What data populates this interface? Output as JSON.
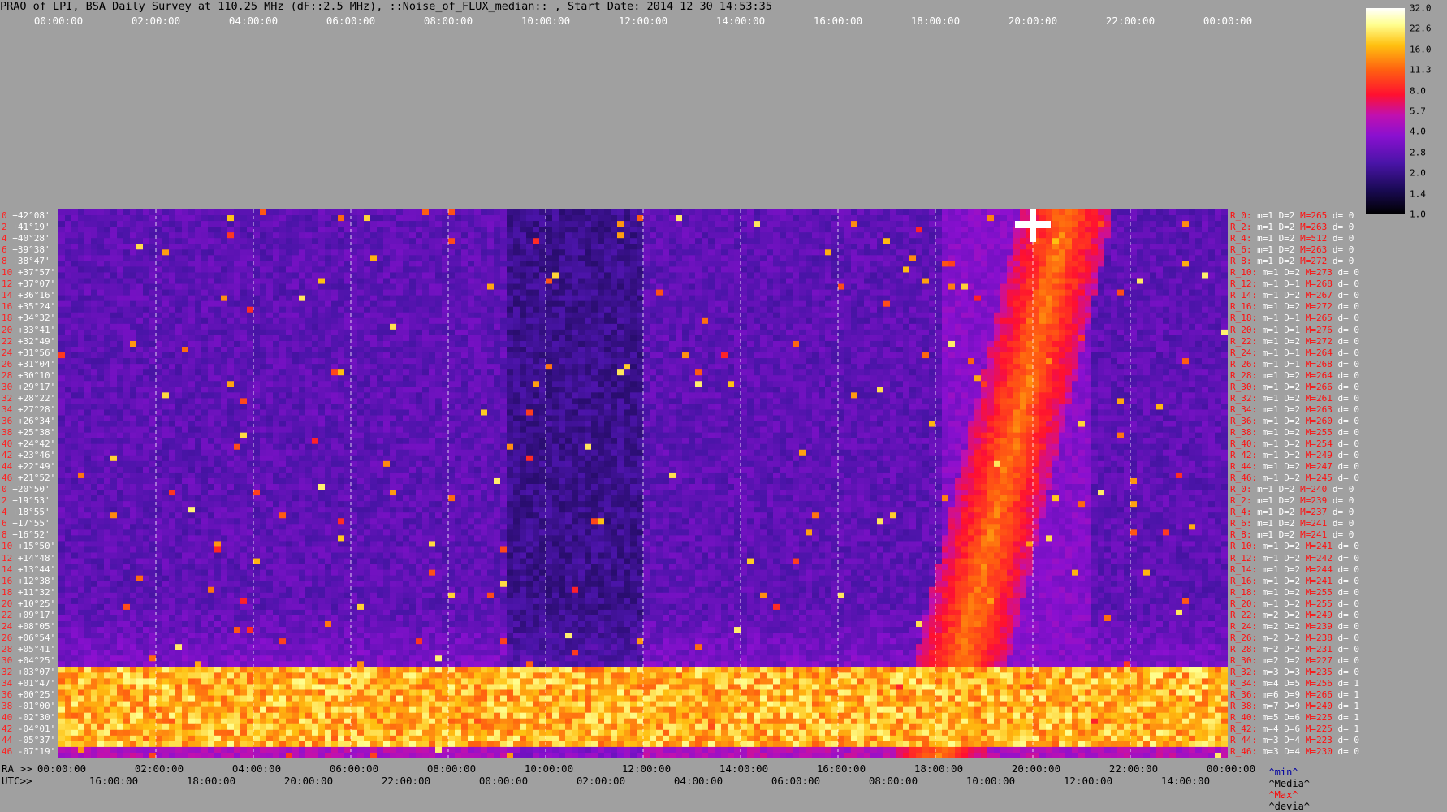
{
  "title": "PRAO of LPI, BSA Daily Survey at 110.25 MHz (dF::2.5 MHz), ::Noise_of_FLUX_median:: , Start Date: 2014 12 30 14:53:35",
  "top_axis_labels": [
    "00:00:00",
    "02:00:00",
    "04:00:00",
    "06:00:00",
    "08:00:00",
    "10:00:00",
    "12:00:00",
    "14:00:00",
    "16:00:00",
    "18:00:00",
    "20:00:00",
    "22:00:00",
    "00:00:00"
  ],
  "ra_axis": {
    "prefix": "RA >>",
    "labels": [
      "00:00:00",
      "02:00:00",
      "04:00:00",
      "06:00:00",
      "08:00:00",
      "10:00:00",
      "12:00:00",
      "14:00:00",
      "16:00:00",
      "18:00:00",
      "20:00:00",
      "22:00:00",
      "00:00:00"
    ]
  },
  "utc_axis": {
    "prefix": "UTC>>",
    "labels": [
      "16:00:00",
      "18:00:00",
      "20:00:00",
      "22:00:00",
      "00:00:00",
      "02:00:00",
      "04:00:00",
      "06:00:00",
      "08:00:00",
      "10:00:00",
      "12:00:00",
      "14:00:00"
    ]
  },
  "declinations": [
    {
      "i": "0",
      "d": "+42°08'"
    },
    {
      "i": "2",
      "d": "+41°19'"
    },
    {
      "i": "4",
      "d": "+40°28'"
    },
    {
      "i": "6",
      "d": "+39°38'"
    },
    {
      "i": "8",
      "d": "+38°47'"
    },
    {
      "i": "10",
      "d": "+37°57'"
    },
    {
      "i": "12",
      "d": "+37°07'"
    },
    {
      "i": "14",
      "d": "+36°16'"
    },
    {
      "i": "16",
      "d": "+35°24'"
    },
    {
      "i": "18",
      "d": "+34°32'"
    },
    {
      "i": "20",
      "d": "+33°41'"
    },
    {
      "i": "22",
      "d": "+32°49'"
    },
    {
      "i": "24",
      "d": "+31°56'"
    },
    {
      "i": "26",
      "d": "+31°04'"
    },
    {
      "i": "28",
      "d": "+30°10'"
    },
    {
      "i": "30",
      "d": "+29°17'"
    },
    {
      "i": "32",
      "d": "+28°22'"
    },
    {
      "i": "34",
      "d": "+27°28'"
    },
    {
      "i": "36",
      "d": "+26°34'"
    },
    {
      "i": "38",
      "d": "+25°38'"
    },
    {
      "i": "40",
      "d": "+24°42'"
    },
    {
      "i": "42",
      "d": "+23°46'"
    },
    {
      "i": "44",
      "d": "+22°49'"
    },
    {
      "i": "46",
      "d": "+21°52'"
    },
    {
      "i": "0",
      "d": "+20°50'"
    },
    {
      "i": "2",
      "d": "+19°53'"
    },
    {
      "i": "4",
      "d": "+18°55'"
    },
    {
      "i": "6",
      "d": "+17°55'"
    },
    {
      "i": "8",
      "d": "+16°52'"
    },
    {
      "i": "10",
      "d": "+15°50'"
    },
    {
      "i": "12",
      "d": "+14°48'"
    },
    {
      "i": "14",
      "d": "+13°44'"
    },
    {
      "i": "16",
      "d": "+12°38'"
    },
    {
      "i": "18",
      "d": "+11°32'"
    },
    {
      "i": "20",
      "d": "+10°25'"
    },
    {
      "i": "22",
      "d": "+09°17'"
    },
    {
      "i": "24",
      "d": "+08°05'"
    },
    {
      "i": "26",
      "d": "+06°54'"
    },
    {
      "i": "28",
      "d": "+05°41'"
    },
    {
      "i": "30",
      "d": "+04°25'"
    },
    {
      "i": "32",
      "d": "+03°07'"
    },
    {
      "i": "34",
      "d": "+01°47'"
    },
    {
      "i": "36",
      "d": "+00°25'"
    },
    {
      "i": "38",
      "d": "-01°00'"
    },
    {
      "i": "40",
      "d": "-02°30'"
    },
    {
      "i": "42",
      "d": "-04°01'"
    },
    {
      "i": "44",
      "d": "-05°37'"
    },
    {
      "i": "46",
      "d": "-07°19'"
    }
  ],
  "stats": [
    {
      "r": "R_0:",
      "m": "m=1 D=2",
      "M": "M=265",
      "d": "d= 0"
    },
    {
      "r": "R_2:",
      "m": "m=1 D=2",
      "M": "M=263",
      "d": "d= 0"
    },
    {
      "r": "R_4:",
      "m": "m=1 D=2",
      "M": "M=512",
      "d": "d= 0"
    },
    {
      "r": "R_6:",
      "m": "m=1 D=2",
      "M": "M=263",
      "d": "d= 0"
    },
    {
      "r": "R_8:",
      "m": "m=1 D=2",
      "M": "M=272",
      "d": "d= 0"
    },
    {
      "r": "R_10:",
      "m": "m=1 D=2",
      "M": "M=273",
      "d": "d= 0"
    },
    {
      "r": "R_12:",
      "m": "m=1 D=1",
      "M": "M=268",
      "d": "d= 0"
    },
    {
      "r": "R_14:",
      "m": "m=1 D=2",
      "M": "M=267",
      "d": "d= 0"
    },
    {
      "r": "R_16:",
      "m": "m=1 D=2",
      "M": "M=272",
      "d": "d= 0"
    },
    {
      "r": "R_18:",
      "m": "m=1 D=1",
      "M": "M=265",
      "d": "d= 0"
    },
    {
      "r": "R_20:",
      "m": "m=1 D=1",
      "M": "M=276",
      "d": "d= 0"
    },
    {
      "r": "R_22:",
      "m": "m=1 D=2",
      "M": "M=272",
      "d": "d= 0"
    },
    {
      "r": "R_24:",
      "m": "m=1 D=1",
      "M": "M=264",
      "d": "d= 0"
    },
    {
      "r": "R_26:",
      "m": "m=1 D=1",
      "M": "M=268",
      "d": "d= 0"
    },
    {
      "r": "R_28:",
      "m": "m=1 D=2",
      "M": "M=264",
      "d": "d= 0"
    },
    {
      "r": "R_30:",
      "m": "m=1 D=2",
      "M": "M=266",
      "d": "d= 0"
    },
    {
      "r": "R_32:",
      "m": "m=1 D=2",
      "M": "M=261",
      "d": "d= 0"
    },
    {
      "r": "R_34:",
      "m": "m=1 D=2",
      "M": "M=263",
      "d": "d= 0"
    },
    {
      "r": "R_36:",
      "m": "m=1 D=2",
      "M": "M=260",
      "d": "d= 0"
    },
    {
      "r": "R_38:",
      "m": "m=1 D=2",
      "M": "M=255",
      "d": "d= 0"
    },
    {
      "r": "R_40:",
      "m": "m=1 D=2",
      "M": "M=254",
      "d": "d= 0"
    },
    {
      "r": "R_42:",
      "m": "m=1 D=2",
      "M": "M=249",
      "d": "d= 0"
    },
    {
      "r": "R_44:",
      "m": "m=1 D=2",
      "M": "M=247",
      "d": "d= 0"
    },
    {
      "r": "R_46:",
      "m": "m=1 D=2",
      "M": "M=245",
      "d": "d= 0"
    },
    {
      "r": "R_0:",
      "m": "m=1 D=2",
      "M": "M=240",
      "d": "d= 0"
    },
    {
      "r": "R_2:",
      "m": "m=1 D=2",
      "M": "M=239",
      "d": "d= 0"
    },
    {
      "r": "R_4:",
      "m": "m=1 D=2",
      "M": "M=237",
      "d": "d= 0"
    },
    {
      "r": "R_6:",
      "m": "m=1 D=2",
      "M": "M=241",
      "d": "d= 0"
    },
    {
      "r": "R_8:",
      "m": "m=1 D=2",
      "M": "M=241",
      "d": "d= 0"
    },
    {
      "r": "R_10:",
      "m": "m=1 D=2",
      "M": "M=241",
      "d": "d= 0"
    },
    {
      "r": "R_12:",
      "m": "m=1 D=2",
      "M": "M=242",
      "d": "d= 0"
    },
    {
      "r": "R_14:",
      "m": "m=1 D=2",
      "M": "M=244",
      "d": "d= 0"
    },
    {
      "r": "R_16:",
      "m": "m=1 D=2",
      "M": "M=241",
      "d": "d= 0"
    },
    {
      "r": "R_18:",
      "m": "m=1 D=2",
      "M": "M=255",
      "d": "d= 0"
    },
    {
      "r": "R_20:",
      "m": "m=1 D=2",
      "M": "M=255",
      "d": "d= 0"
    },
    {
      "r": "R_22:",
      "m": "m=2 D=2",
      "M": "M=249",
      "d": "d= 0"
    },
    {
      "r": "R_24:",
      "m": "m=2 D=2",
      "M": "M=239",
      "d": "d= 0"
    },
    {
      "r": "R_26:",
      "m": "m=2 D=2",
      "M": "M=238",
      "d": "d= 0"
    },
    {
      "r": "R_28:",
      "m": "m=2 D=2",
      "M": "M=231",
      "d": "d= 0"
    },
    {
      "r": "R_30:",
      "m": "m=2 D=2",
      "M": "M=227",
      "d": "d= 0"
    },
    {
      "r": "R_32:",
      "m": "m=3 D=3",
      "M": "M=235",
      "d": "d= 0"
    },
    {
      "r": "R_34:",
      "m": "m=4 D=5",
      "M": "M=256",
      "d": "d= 1"
    },
    {
      "r": "R_36:",
      "m": "m=6 D=9",
      "M": "M=266",
      "d": "d= 1"
    },
    {
      "r": "R_38:",
      "m": "m=7 D=9",
      "M": "M=240",
      "d": "d= 1"
    },
    {
      "r": "R_40:",
      "m": "m=5 D=6",
      "M": "M=225",
      "d": "d= 1"
    },
    {
      "r": "R_42:",
      "m": "m=4 D=6",
      "M": "M=225",
      "d": "d= 1"
    },
    {
      "r": "R_44:",
      "m": "m=3 D=4",
      "M": "M=223",
      "d": "d= 0"
    },
    {
      "r": "R_46:",
      "m": "m=3 D=4",
      "M": "M=230",
      "d": "d= 0"
    }
  ],
  "colorbar_labels": [
    "32.0",
    "22.6",
    "16.0",
    "11.3",
    "8.0",
    "5.7",
    "4.0",
    "2.8",
    "2.0",
    "1.4",
    "1.0"
  ],
  "legend": {
    "min": "^min^",
    "median": "^Media^",
    "max": "^Max^",
    "dev": "^devia^"
  },
  "colors": {
    "min": "#0000a0",
    "median": "#000000",
    "max": "#ff0000",
    "dev": "#000000"
  },
  "chart_data": {
    "type": "heatmap",
    "title": "PRAO of LPI, BSA Daily Survey at 110.25 MHz (dF::2.5 MHz), ::Noise_of_FLUX_median:: , Start Date: 2014 12 30 14:53:35",
    "xlabel": "RA >> / UTC>>",
    "x_ticks_ra": [
      "00:00:00",
      "02:00:00",
      "04:00:00",
      "06:00:00",
      "08:00:00",
      "10:00:00",
      "12:00:00",
      "14:00:00",
      "16:00:00",
      "18:00:00",
      "20:00:00",
      "22:00:00",
      "00:00:00"
    ],
    "x_ticks_utc": [
      "16:00:00",
      "18:00:00",
      "20:00:00",
      "22:00:00",
      "00:00:00",
      "02:00:00",
      "04:00:00",
      "06:00:00",
      "08:00:00",
      "10:00:00",
      "12:00:00",
      "14:00:00"
    ],
    "colorbar_scale": "log",
    "colorbar_range": [
      1.0,
      32.0
    ],
    "features": [
      {
        "name": "bright horizontal band",
        "dec_range": [
          "+01°47'",
          "-07°19'"
        ],
        "level": 11.3
      },
      {
        "name": "bright diagonal feature",
        "ra_range": [
          "18:30:00",
          "21:00:00"
        ],
        "level": 8.0
      },
      {
        "name": "bright source",
        "ra": "20:00:00",
        "dec": "+41°19'",
        "level": 32.0
      }
    ]
  }
}
